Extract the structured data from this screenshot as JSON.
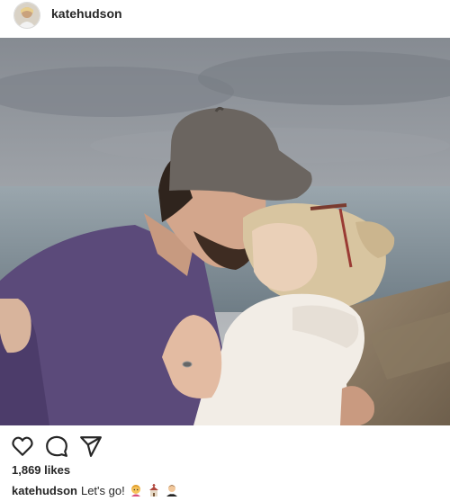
{
  "post": {
    "username": "katehudson",
    "likes_text": "1,869 likes",
    "caption_user": "katehudson",
    "caption_text": "Let's go!",
    "caption_emojis": [
      "woman-emoji",
      "church-emoji",
      "man-in-tuxedo-emoji"
    ]
  },
  "icons": {
    "like": "heart-icon",
    "comment": "comment-icon",
    "share": "paper-plane-icon"
  },
  "colors": {
    "text": "#262626",
    "border": "#dbdbdb",
    "background": "#ffffff"
  }
}
